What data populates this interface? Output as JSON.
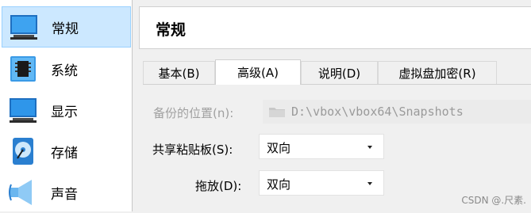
{
  "sidebar": {
    "items": [
      {
        "label": "常规",
        "icon": "general-monitor-icon"
      },
      {
        "label": "系统",
        "icon": "chip-icon"
      },
      {
        "label": "显示",
        "icon": "monitor-icon"
      },
      {
        "label": "存储",
        "icon": "disk-icon"
      },
      {
        "label": "声音",
        "icon": "speaker-icon"
      }
    ],
    "selected_index": 0
  },
  "header": {
    "title": "常规"
  },
  "tabs": [
    {
      "label": "基本(B)"
    },
    {
      "label": "高级(A)"
    },
    {
      "label": "说明(D)"
    },
    {
      "label": "虚拟盘加密(R)"
    }
  ],
  "active_tab_index": 1,
  "form": {
    "snapshot_location": {
      "label": "备份的位置(n):",
      "value": "D:\\vbox\\vbox64\\Snapshots",
      "disabled": true
    },
    "clipboard": {
      "label": "共享粘贴板(S):",
      "value": "双向"
    },
    "drag_drop": {
      "label": "拖放(D):",
      "value": "双向"
    }
  },
  "watermark": "CSDN @.尺素.",
  "colors": {
    "selection_bg": "#cce8ff",
    "selection_border": "#99d1ff",
    "icon_blue": "#1e88d8"
  }
}
